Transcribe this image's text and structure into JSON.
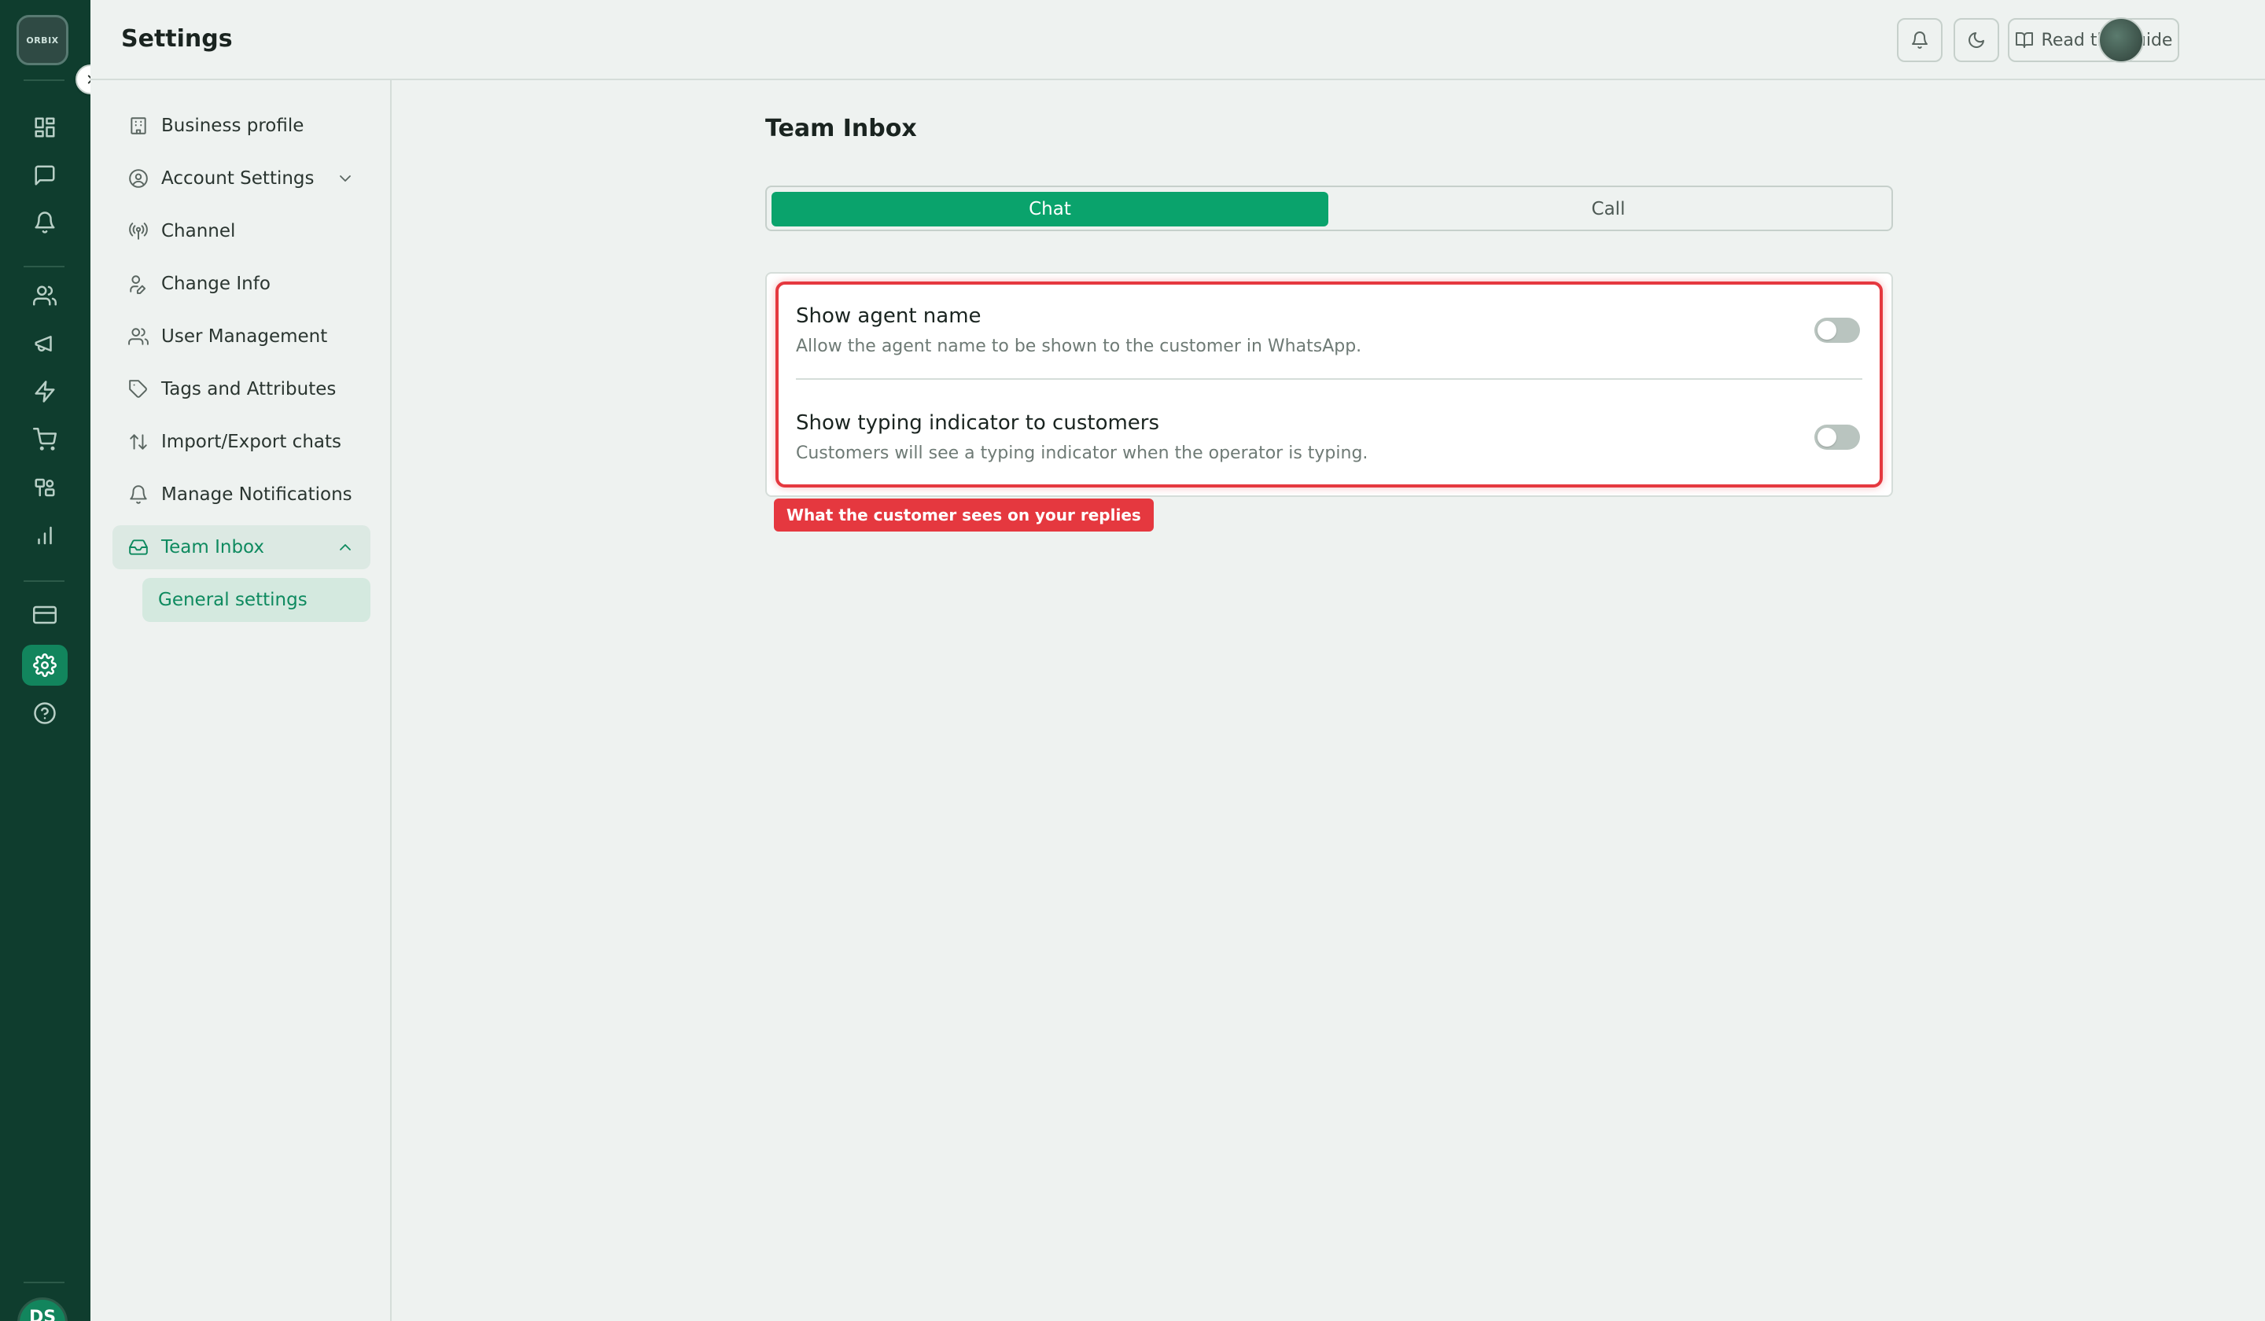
{
  "app": {
    "logo_text": "ORBIX",
    "avatar_initials": "DS"
  },
  "header": {
    "title": "Settings",
    "guide_label": "Read the guide"
  },
  "subnav": {
    "items": [
      {
        "label": "Business profile",
        "icon": "building-icon"
      },
      {
        "label": "Account Settings",
        "icon": "user-circle-icon"
      },
      {
        "label": "Channel",
        "icon": "broadcast-icon"
      },
      {
        "label": "Change Info",
        "icon": "user-edit-icon"
      },
      {
        "label": "User Management",
        "icon": "users-icon"
      },
      {
        "label": "Tags and Attributes",
        "icon": "tag-icon"
      },
      {
        "label": "Import/Export chats",
        "icon": "arrows-updown-icon"
      },
      {
        "label": "Manage Notifications",
        "icon": "bell-icon"
      },
      {
        "label": "Team Inbox",
        "icon": "inbox-icon"
      }
    ],
    "sub_items": [
      {
        "label": "General settings"
      }
    ]
  },
  "main": {
    "section_title": "Team Inbox",
    "tabs": [
      {
        "label": "Chat",
        "active": true
      },
      {
        "label": "Call",
        "active": false
      }
    ],
    "settings": [
      {
        "title": "Show agent name",
        "description": "Allow the agent name to be shown to the customer in WhatsApp.",
        "enabled": false
      },
      {
        "title": "Show typing indicator to customers",
        "description": "Customers will see a typing indicator when the operator is typing.",
        "enabled": false
      }
    ],
    "callout": "What the customer sees on your replies"
  },
  "colors": {
    "rail_bg": "#0f3d2e",
    "accent": "#0aa36c",
    "highlight": "#e5383f"
  }
}
